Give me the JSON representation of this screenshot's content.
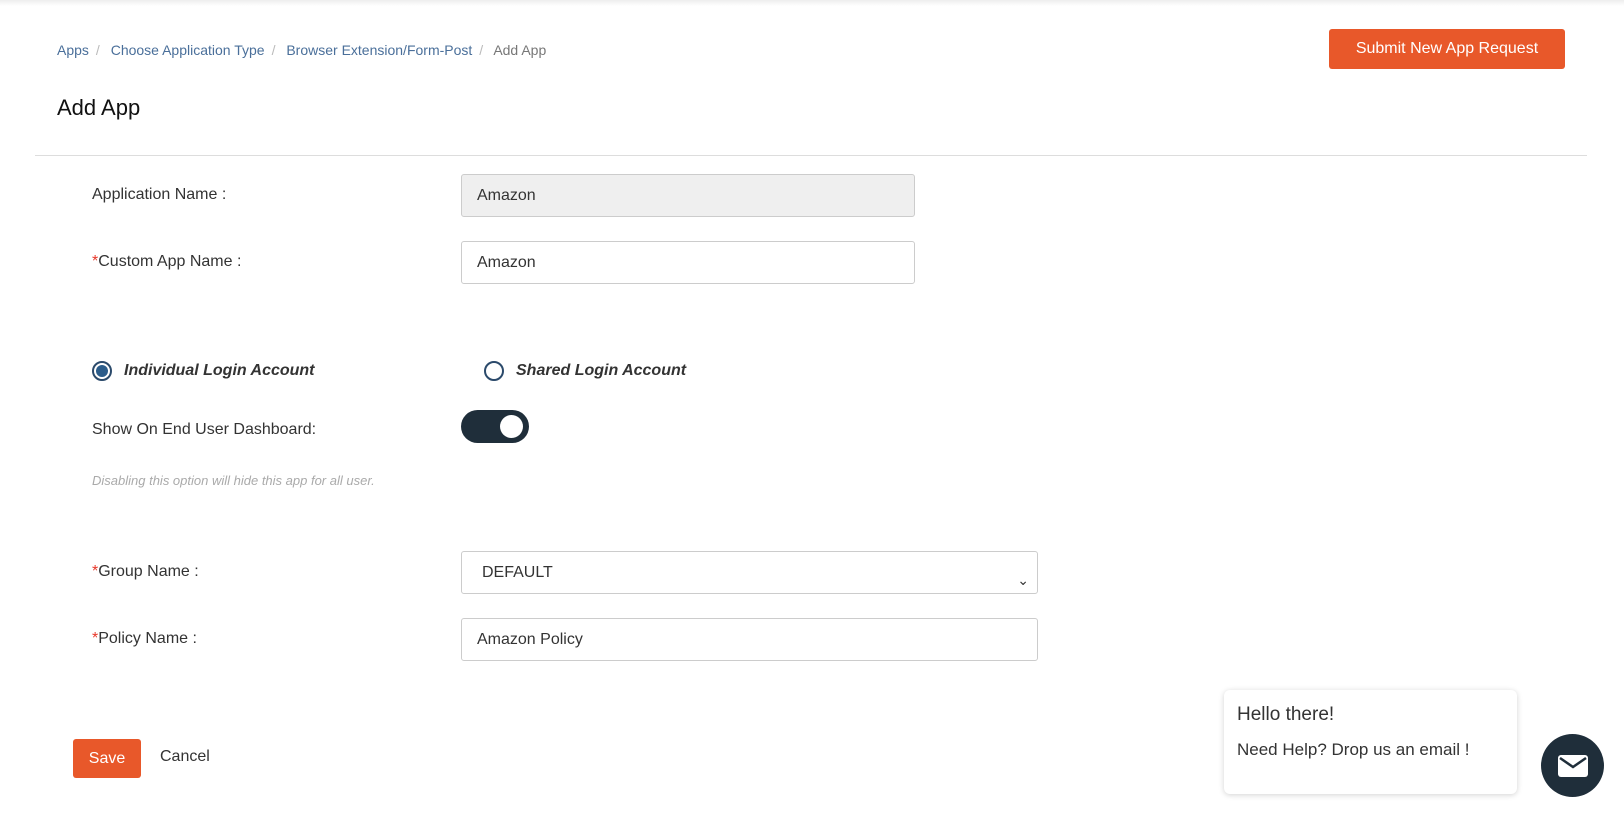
{
  "breadcrumb": [
    "Apps",
    "Choose Application Type",
    "Browser Extension/Form-Post",
    "Add App"
  ],
  "page_title": "Add App",
  "submit_label": "Submit New App Request",
  "form": {
    "app_name_label": "Application Name :",
    "app_name_value": "Amazon",
    "custom_name_label": "Custom App Name :",
    "custom_name_value": "Amazon",
    "radio_individual": "Individual Login Account",
    "radio_shared": "Shared Login Account",
    "show_label": "Show On End User Dashboard:",
    "show_enabled": true,
    "hint": "Disabling this option will hide this app for all user.",
    "group_label": "Group Name :",
    "group_value": "DEFAULT",
    "policy_label": "Policy Name :",
    "policy_value": "Amazon Policy",
    "required_mark": "*"
  },
  "save_label": "Save",
  "cancel_label": "Cancel",
  "chat": {
    "greeting": "Hello there!",
    "message": "Need Help? Drop us an email !"
  }
}
